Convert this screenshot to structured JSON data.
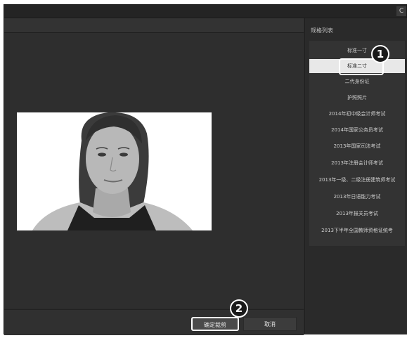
{
  "window": {
    "close_label": "C"
  },
  "sidebar": {
    "header": "规格列表",
    "items": [
      "标准一寸",
      "标准二寸",
      "二代身份证",
      "护照照片",
      "2014年初中级会计师考试",
      "2014年国家公务员考试",
      "2013年国家司法考试",
      "2013年注册会计师考试",
      "2013年一级、二级注册建筑师考试",
      "2013年日语能力考试",
      "2013年报关员考试",
      "2013下半年全国教师资格证统考"
    ],
    "selected_index": 1
  },
  "actions": {
    "confirm_label": "确定裁剪",
    "cancel_label": "取消"
  },
  "badges": {
    "one": "1",
    "two": "2"
  },
  "icons": {
    "close": "close-icon"
  }
}
